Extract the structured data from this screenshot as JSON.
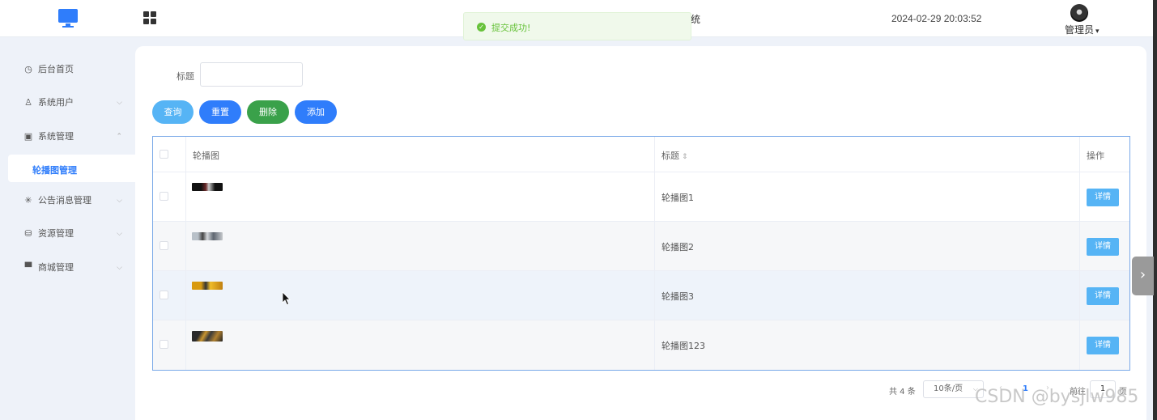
{
  "header": {
    "system_title_fragment": "统",
    "datetime": "2024-02-29 20:03:52",
    "user_name": "管理员",
    "user_dropdown_glyph": "▾"
  },
  "toast": {
    "message": "提交成功!",
    "status_color": "#67c23a"
  },
  "sidebar": {
    "items": [
      {
        "label": "后台首页",
        "icon": "clock-icon",
        "glyph": "◷",
        "arrow": ""
      },
      {
        "label": "系统用户",
        "icon": "user-icon",
        "glyph": "♙",
        "arrow": "⌵"
      },
      {
        "label": "系统管理",
        "icon": "folder-icon",
        "glyph": "▣",
        "arrow": "⌃"
      },
      {
        "label": "公告消息管理",
        "icon": "loading-icon",
        "glyph": "✳",
        "arrow": "⌵"
      },
      {
        "label": "资源管理",
        "icon": "database-icon",
        "glyph": "⛁",
        "arrow": "⌵"
      },
      {
        "label": "商城管理",
        "icon": "shop-icon",
        "glyph": "▀",
        "arrow": "⌵"
      }
    ],
    "active_sub_item": "轮播图管理"
  },
  "search": {
    "label": "标题",
    "value": ""
  },
  "buttons": {
    "search": "查询",
    "reset": "重置",
    "delete": "删除",
    "add": "添加"
  },
  "table": {
    "columns": {
      "image": "轮播图",
      "title": "标题",
      "title_sort_glyph": "⇕",
      "operation": "操作"
    },
    "rows": [
      {
        "title": "轮播图1",
        "action": "详情",
        "thumb_color": "#1a1a1a"
      },
      {
        "title": "轮播图2",
        "action": "详情",
        "thumb_color": "#7d8690"
      },
      {
        "title": "轮播图3",
        "action": "详情",
        "thumb_color": "#e0a318"
      },
      {
        "title": "轮播图123",
        "action": "详情",
        "thumb_color": "#8a6a2c"
      }
    ]
  },
  "pagination": {
    "total": "共 4 条",
    "page_size": "10条/页",
    "prev": "‹",
    "current_page": "1",
    "next": "›",
    "goto_label": "前往",
    "goto_value": "1",
    "unit": "页"
  },
  "side_toggle": {
    "glyph": "›"
  },
  "watermark": "CSDN @bysjlw985",
  "colors": {
    "primary": "#2f7dfb",
    "info": "#56b4f5",
    "success": "#3aa14a"
  }
}
